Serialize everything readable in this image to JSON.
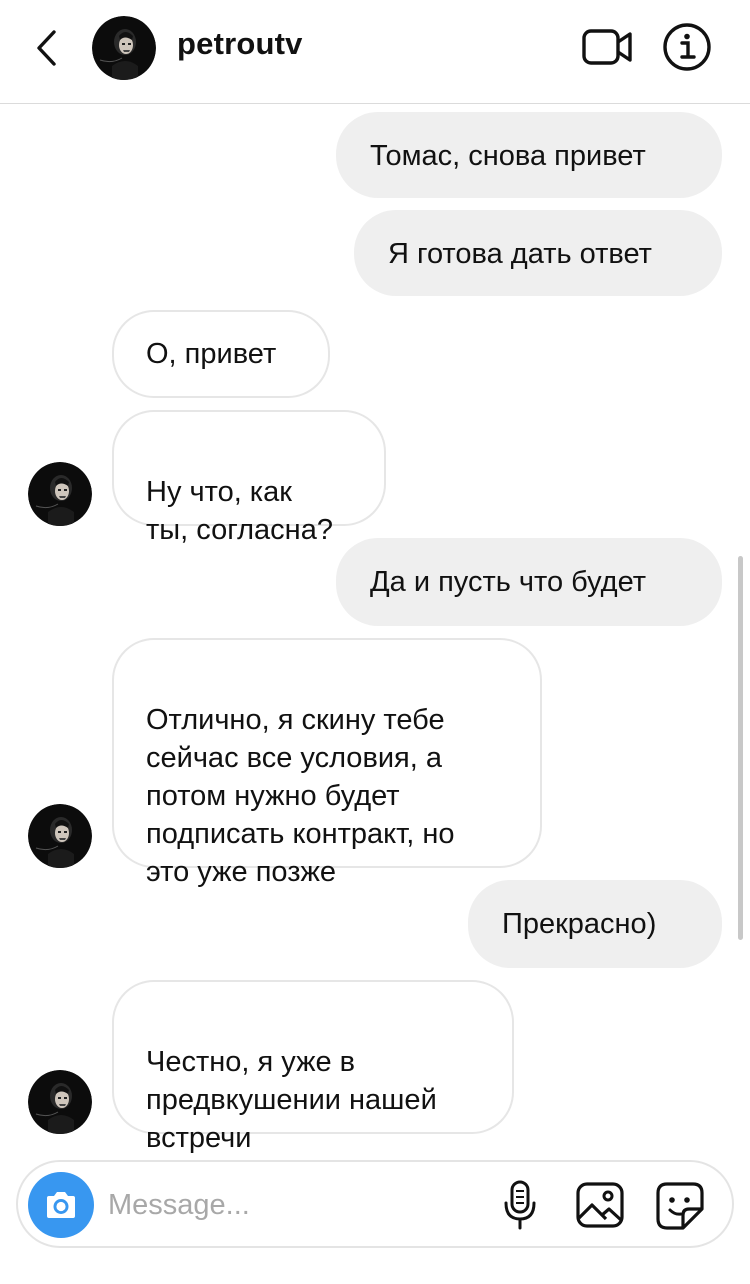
{
  "header": {
    "username": "petroutv"
  },
  "messages": [
    {
      "direction": "outgoing",
      "text": "Томас, снова привет"
    },
    {
      "direction": "outgoing",
      "text": "Я готова дать ответ"
    },
    {
      "direction": "incoming",
      "text": "О, привет"
    },
    {
      "direction": "incoming",
      "text": "Ну что, как\nты, согласна?"
    },
    {
      "direction": "outgoing",
      "text": "Да и пусть что будет"
    },
    {
      "direction": "incoming",
      "text": "Отлично, я скину тебе\nсейчас все условия, а\nпотом нужно будет\nподписать контракт, но\nэто уже позже"
    },
    {
      "direction": "outgoing",
      "text": "Прекрасно)"
    },
    {
      "direction": "incoming",
      "text": "Честно, я уже в\nпредвкушении нашей\nвстречи"
    }
  ],
  "composer": {
    "placeholder": "Message...",
    "value": ""
  },
  "icons": {
    "back": "chevron-left-icon",
    "video": "video-camera-icon",
    "info": "info-icon",
    "camera": "camera-icon",
    "mic": "microphone-icon",
    "gallery": "image-icon",
    "sticker": "sticker-icon"
  },
  "colors": {
    "accent": "#3897f0",
    "outgoing_bubble": "#efefef",
    "incoming_border": "#e6e6e6",
    "placeholder": "#a8a8a8"
  }
}
